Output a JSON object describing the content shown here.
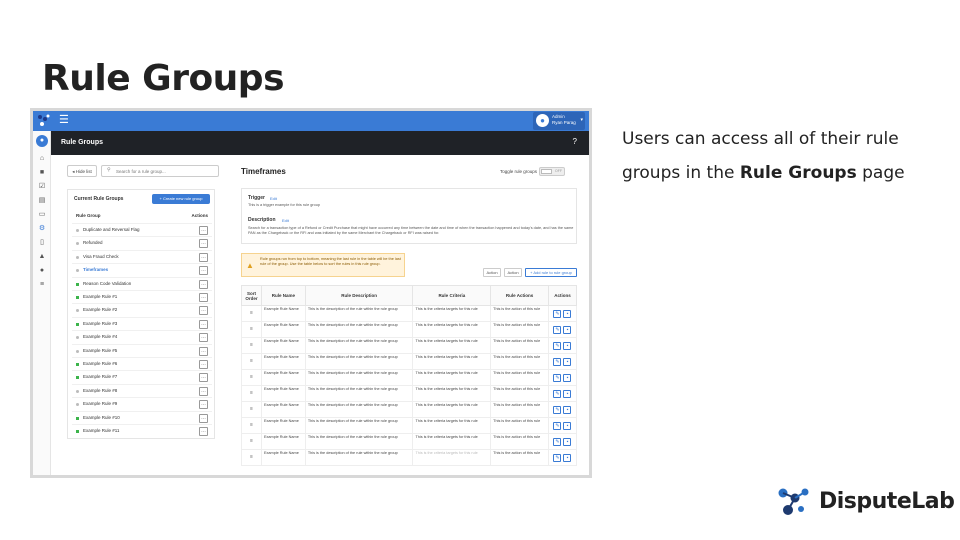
{
  "slide": {
    "title": "Rule Groups",
    "desc_pre": "Users can access all of their rule groups in the ",
    "desc_bold": "Rule Groups",
    "desc_post": " page",
    "brand": "DisputeLab"
  },
  "app": {
    "user_role": "Admin",
    "user_name": "Ryan Parag",
    "page_title": "Rule Groups",
    "hide_list": "Hide list",
    "search_placeholder": "Search for a rule group...",
    "current_groups_title": "Current Rule Groups",
    "create_button": "Create new rule group",
    "col_rule_group": "Rule Group",
    "col_actions": "Actions",
    "groups": [
      {
        "label": "Duplicate and Reversal Flag",
        "color": "grey",
        "selected": false
      },
      {
        "label": "Refunded",
        "color": "grey",
        "selected": false
      },
      {
        "label": "Visa Fraud Check",
        "color": "grey",
        "selected": false
      },
      {
        "label": "Timeframes",
        "color": "grey",
        "selected": true
      },
      {
        "label": "Reason Code Validation",
        "color": "green",
        "selected": false
      },
      {
        "label": "Example Rule #1",
        "color": "green",
        "selected": false
      },
      {
        "label": "Example Rule #2",
        "color": "grey",
        "selected": false
      },
      {
        "label": "Example Rule #3",
        "color": "green",
        "selected": false
      },
      {
        "label": "Example Rule #4",
        "color": "grey",
        "selected": false
      },
      {
        "label": "Example Rule #5",
        "color": "grey",
        "selected": false
      },
      {
        "label": "Example Rule #6",
        "color": "green",
        "selected": false
      },
      {
        "label": "Example Rule #7",
        "color": "green",
        "selected": false
      },
      {
        "label": "Example Rule #8",
        "color": "grey",
        "selected": false
      },
      {
        "label": "Example Rule #9",
        "color": "grey",
        "selected": false
      },
      {
        "label": "Example Rule #10",
        "color": "green",
        "selected": false
      },
      {
        "label": "Example Rule #11",
        "color": "green",
        "selected": false
      }
    ],
    "detail": {
      "title": "Timeframes",
      "toggle_label": "Toggle rule groups",
      "toggle_state": "OFF",
      "trigger_label": "Trigger",
      "edit": "Edit",
      "trigger_text": "This is a trigger example for this rule group",
      "description_label": "Description",
      "description_text": "Search for a transaction type of a Refund or Credit Purchase that might have occurred any time between the date and time of when the transaction happened and today's date, and has the same PAN as the Chargeback or the RFI and was initiated by the same Merchant the Chargeback or RFI was raised for.",
      "warning": "Rule groups run from top to bottom, meaning the last rule in the table will be the last rule of the group. Use the table below to sort the rules in this rule group.",
      "action1": "Action",
      "action2": "Action",
      "add_rule": "+ Add rule to rule group",
      "columns": [
        "Sort Order",
        "Rule Name",
        "Rule Description",
        "Rule Criteria",
        "Rule Actions",
        "Actions"
      ],
      "rule_name": "Example Rule Name",
      "rule_desc": "This is the description of the rule within the rule group",
      "rule_criteria": "This is the criteria targets for this rule",
      "rule_action": "This is the action of this rule",
      "row_count": 10
    }
  },
  "colors": {
    "accent": "#3a7bd5",
    "dark_bar": "#1f2227",
    "green": "#3cb44b",
    "warning_bg": "#fff3dc"
  }
}
